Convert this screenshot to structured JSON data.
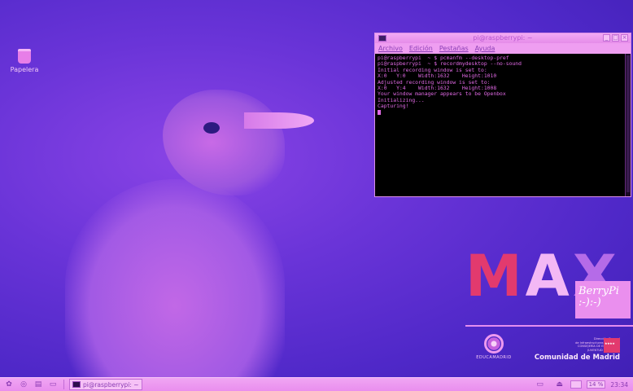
{
  "desktop": {
    "icons": [
      {
        "label": "Papelera",
        "icon": "trash-icon"
      }
    ]
  },
  "terminal": {
    "title": "pi@raspberrypi: ~",
    "menu": [
      "Archivo",
      "Edición",
      "Pestañas",
      "Ayuda"
    ],
    "lines": [
      "pi@raspberrypi  ~ $ pcmanfm --desktop-pref",
      "pi@raspberrypi  ~ $ recordmydesktop --no-sound",
      "Initial recording window is set to:",
      "X:0   Y:0    Width:1632    Height:1010",
      "Adjusted recording window is set to:",
      "X:0   Y:4    Width:1632    Height:1008",
      "Your window manager appears to be Openbox",
      "",
      "Initializing...",
      "Capturing!"
    ]
  },
  "branding": {
    "max_m": "M",
    "max_a": "A",
    "max_x": "X",
    "berry_line1": "BerryPi",
    "berry_line2": ":-):-)",
    "educa": "EDUCAMADRID",
    "madrid_small_1": "Dirección General",
    "madrid_small_2": "de Infraestructuras y Servicios",
    "madrid_small_3": "CONSEJERÍA DE EDUCACIÓN,",
    "madrid_small_4": "JUVENTUD Y DEPORTE",
    "madrid_big": "Comunidad de Madrid"
  },
  "taskbar": {
    "task_label": "pi@raspberrypi: ~",
    "keyboard": "14 %",
    "clock": "23:34"
  },
  "colors": {
    "accent": "#e98eee",
    "terminal_text": "#e26ae6",
    "max_red": "#e23a6e"
  }
}
